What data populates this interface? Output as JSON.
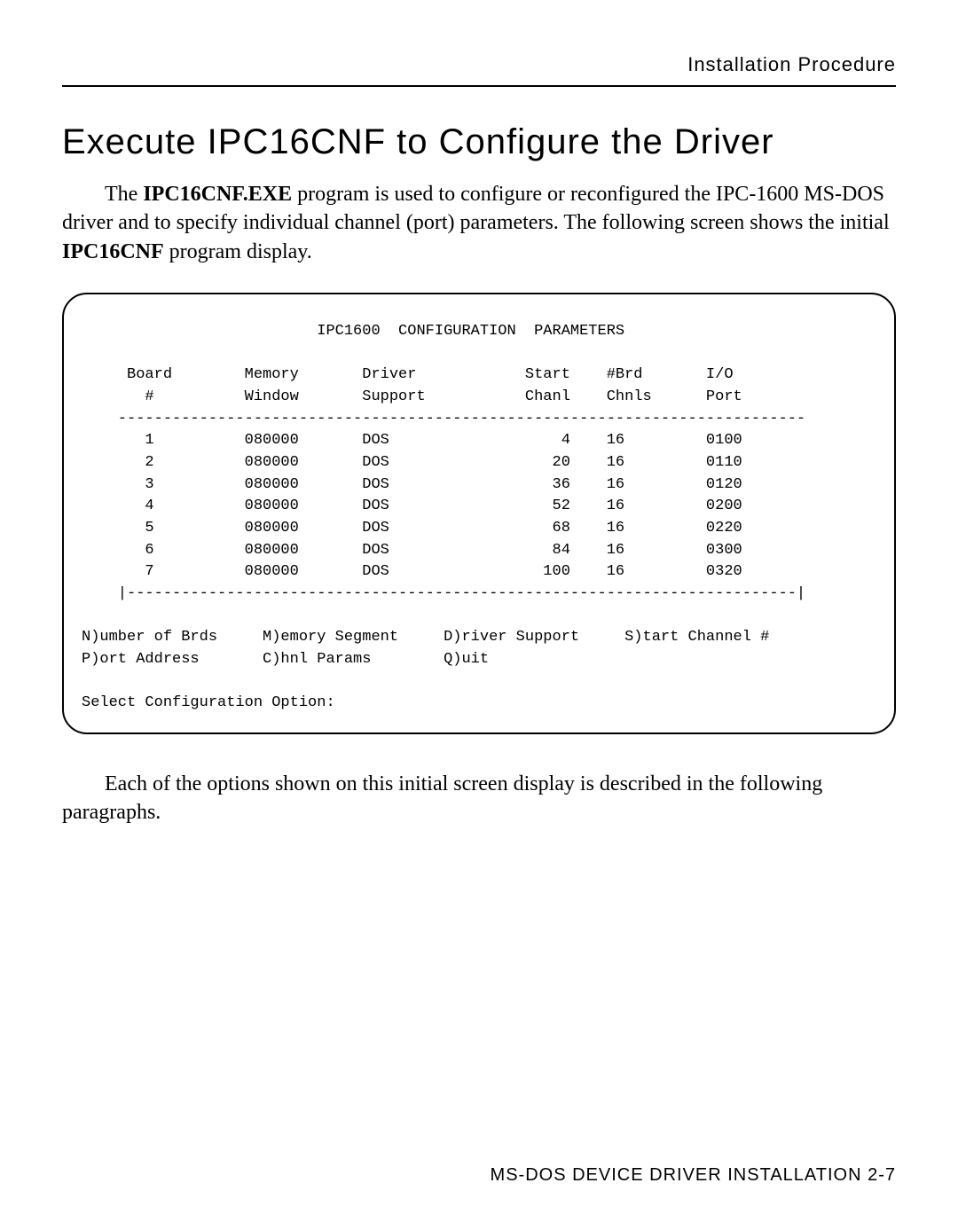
{
  "running_head": "Installation Procedure",
  "heading": "Execute IPC16CNF to Configure the Driver",
  "intro_parts": {
    "p1a": "The ",
    "p1b_bold": "IPC16CNF.EXE",
    "p1c": " program is used to configure or reconfigured the IPC-1600 MS-DOS driver and to specify individual channel (port) parameters. The following screen shows the initial ",
    "p1d_bold": "IPC16CNF",
    "p1e": " program display."
  },
  "terminal": {
    "title": "IPC1600  CONFIGURATION  PARAMETERS",
    "headers": {
      "board": "Board",
      "board_sub": "#",
      "memory": "Memory",
      "memory_sub": "Window",
      "driver": "Driver",
      "driver_sub": "Support",
      "start": "Start",
      "start_sub": "Chanl",
      "brd": "#Brd",
      "brd_sub": "Chnls",
      "io": "I/O",
      "io_sub": "Port"
    },
    "rows": [
      {
        "n": "1",
        "mem": "080000",
        "drv": "DOS",
        "start": "4",
        "chnls": "16",
        "port": "0100"
      },
      {
        "n": "2",
        "mem": "080000",
        "drv": "DOS",
        "start": "20",
        "chnls": "16",
        "port": "0110"
      },
      {
        "n": "3",
        "mem": "080000",
        "drv": "DOS",
        "start": "36",
        "chnls": "16",
        "port": "0120"
      },
      {
        "n": "4",
        "mem": "080000",
        "drv": "DOS",
        "start": "52",
        "chnls": "16",
        "port": "0200"
      },
      {
        "n": "5",
        "mem": "080000",
        "drv": "DOS",
        "start": "68",
        "chnls": "16",
        "port": "0220"
      },
      {
        "n": "6",
        "mem": "080000",
        "drv": "DOS",
        "start": "84",
        "chnls": "16",
        "port": "0300"
      },
      {
        "n": "7",
        "mem": "080000",
        "drv": "DOS",
        "start": "100",
        "chnls": "16",
        "port": "0320"
      }
    ],
    "options_line1": {
      "n": "N)umber of Brds",
      "m": "M)emory Segment",
      "d": "D)river Support",
      "s": "S)tart Channel #"
    },
    "options_line2": {
      "p": "P)ort Address",
      "c": "C)hnl Params",
      "q": "Q)uit"
    },
    "prompt": "Select Configuration Option:"
  },
  "chart_data": {
    "type": "table",
    "title": "IPC1600 CONFIGURATION PARAMETERS",
    "columns": [
      "Board #",
      "Memory Window",
      "Driver Support",
      "Start Chanl",
      "#Brd Chnls",
      "I/O Port"
    ],
    "rows": [
      [
        "1",
        "080000",
        "DOS",
        4,
        16,
        "0100"
      ],
      [
        "2",
        "080000",
        "DOS",
        20,
        16,
        "0110"
      ],
      [
        "3",
        "080000",
        "DOS",
        36,
        16,
        "0120"
      ],
      [
        "4",
        "080000",
        "DOS",
        52,
        16,
        "0200"
      ],
      [
        "5",
        "080000",
        "DOS",
        68,
        16,
        "0220"
      ],
      [
        "6",
        "080000",
        "DOS",
        84,
        16,
        "0300"
      ],
      [
        "7",
        "080000",
        "DOS",
        100,
        16,
        "0320"
      ]
    ]
  },
  "outro": "Each of the options shown on this initial screen display is described in the following paragraphs.",
  "footer": "MS-DOS DEVICE DRIVER INSTALLATION  2-7"
}
